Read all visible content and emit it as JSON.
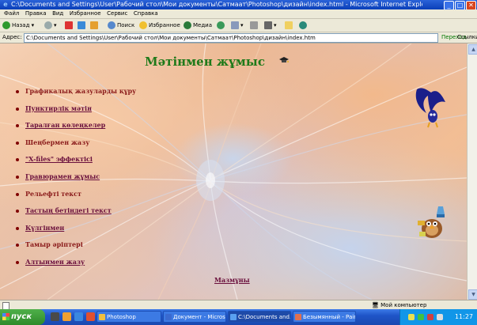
{
  "window": {
    "title": "C:\\Documents and Settings\\User\\Рабочий стол\\Мои документы\\Сатмаат\\Photoshop\\дизайн\\index.html - Microsoft Internet Explorer",
    "minimize": "_",
    "maximize": "□",
    "close": "✕"
  },
  "menubar": [
    "Файл",
    "Правка",
    "Вид",
    "Избранное",
    "Сервис",
    "Справка"
  ],
  "toolbar": {
    "back": "Назад",
    "search": "Поиск",
    "favorites": "Избранное",
    "media": "Медиа"
  },
  "address": {
    "label": "Адрес:",
    "value": "C:\\Documents and Settings\\User\\Рабочий стол\\Мои документы\\Сатмаат\\Photoshop\\дизайн\\index.htm",
    "go": "Переход",
    "links": "Ссылки"
  },
  "page": {
    "heading": "Мәтінмен жұмыс",
    "items": [
      {
        "label": "Графикалық жазуларды құру",
        "link": false
      },
      {
        "label": "Пунктирлік мәтін",
        "link": true
      },
      {
        "label": "Таралған көлеңкелер",
        "link": true
      },
      {
        "label": "Шеңбермен жазу",
        "link": false
      },
      {
        "label": "\"X-files\" эффектісі",
        "link": true
      },
      {
        "label": "Гравюрамен жұмыс",
        "link": true
      },
      {
        "label": "Рельефті текст",
        "link": false
      },
      {
        "label": "Тастың бетіндегі текст",
        "link": true
      },
      {
        "label": "Күлгінмен",
        "link": true
      },
      {
        "label": "Тамыр әріптері",
        "link": false
      },
      {
        "label": "Алтынмен жазу",
        "link": true
      }
    ],
    "home_link": "Мазмұны"
  },
  "statusbar": {
    "zone": "Мой компьютер"
  },
  "taskbar": {
    "start": "пуск",
    "tasks": [
      "Photoshop",
      "Документ - Microsoft",
      "C:\\Documents and...",
      "Безымянный - Paint"
    ],
    "clock": "11:27"
  }
}
